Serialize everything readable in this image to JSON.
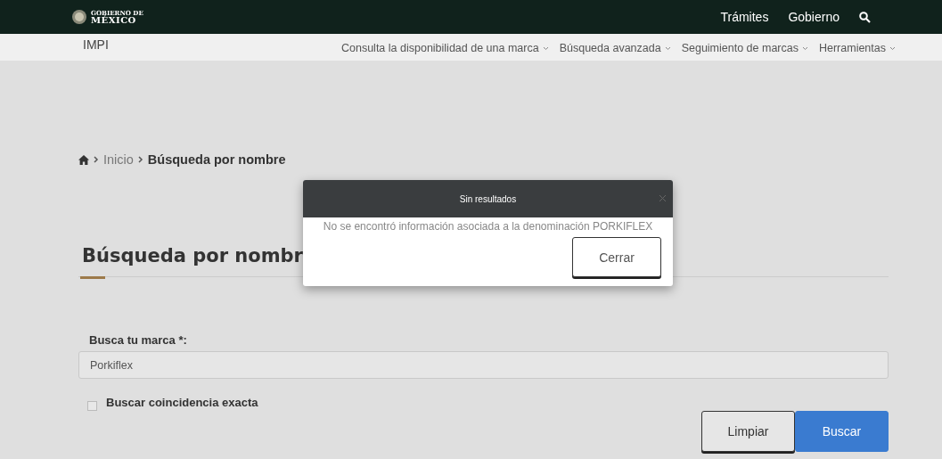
{
  "top_bar": {
    "logo_small": "GOBIERNO DE",
    "logo_large": "MÉXICO",
    "links": [
      "Trámites",
      "Gobierno"
    ]
  },
  "sub_nav": {
    "brand": "IMPI",
    "menus": [
      "Consulta la disponibilidad de una marca",
      "Búsqueda avanzada",
      "Seguimiento de marcas",
      "Herramientas"
    ]
  },
  "breadcrumb": {
    "items": [
      "Inicio",
      "Búsqueda por nombre"
    ]
  },
  "heading": "Búsqueda por nombr",
  "form": {
    "label": "Busca tu marca",
    "required_mark": "*:",
    "value": "Porkiflex",
    "exact_match": {
      "label": "Buscar coincidencia exacta",
      "checked": false
    },
    "buttons": [
      {
        "label": "Limpiar",
        "kind": "secondary"
      },
      {
        "label": "Buscar",
        "kind": "primary"
      }
    ]
  },
  "dialog": {
    "title": "Sin resultados",
    "message": "No se encontró información asociada a la denominación PORKIFLEX",
    "button": "Cerrar"
  }
}
